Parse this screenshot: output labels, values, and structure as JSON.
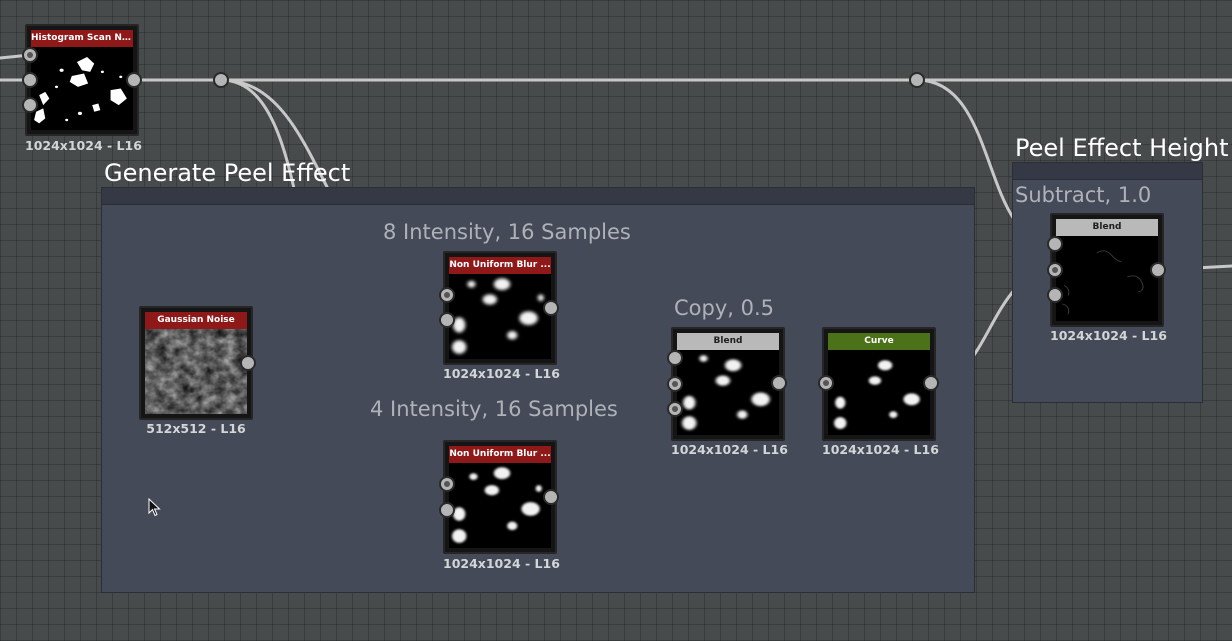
{
  "frames": {
    "generate": {
      "title": "Generate Peel Effect"
    },
    "peel_height": {
      "title": "Peel Effect Height"
    }
  },
  "comments": {
    "blur_top": "8 Intensity, 16 Samples",
    "blur_bottom": "4 Intensity, 16 Samples",
    "copy": "Copy, 0.5",
    "subtract": "Subtract, 1.0"
  },
  "nodes": {
    "histogram": {
      "title": "Histogram Scan No...",
      "res": "1024x1024 - L16",
      "color": "#8f1818"
    },
    "gaussian": {
      "title": "Gaussian Noise",
      "res": "512x512 - L16",
      "color": "#8f1818"
    },
    "blur_top": {
      "title": "Non Uniform Blur ...",
      "res": "1024x1024 - L16",
      "color": "#8f1818"
    },
    "blur_bottom": {
      "title": "Non Uniform Blur ...",
      "res": "1024x1024 - L16",
      "color": "#8f1818"
    },
    "blend_copy": {
      "title": "Blend",
      "res": "1024x1024 - L16",
      "color": "#b9b9b9"
    },
    "curve": {
      "title": "Curve",
      "res": "1024x1024 - L16",
      "color": "#4b7218"
    },
    "blend_subtract": {
      "title": "Blend",
      "res": "1024x1024 - L16",
      "color": "#b9b9b9"
    }
  },
  "colors": {
    "graph_background": "#474b4b",
    "frame_background": "#454a58",
    "wire": "#c8c8c8",
    "port": "#b5b5b5"
  },
  "icons": [
    "mouse-cursor-icon"
  ]
}
